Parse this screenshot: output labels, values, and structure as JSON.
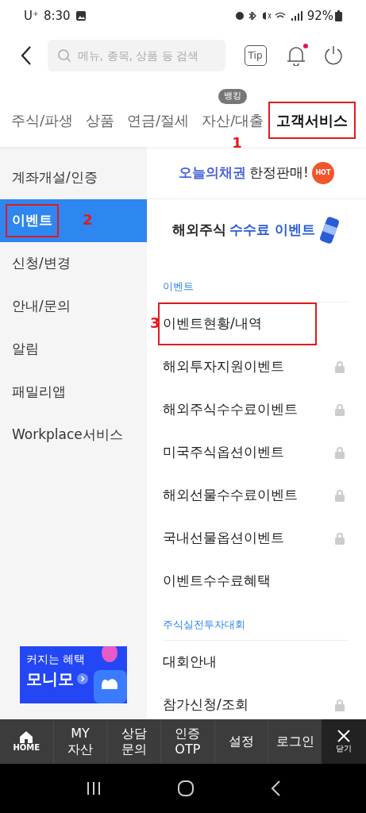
{
  "status_bar": {
    "carrier": "U⁺",
    "time": "8:30",
    "battery": "92%"
  },
  "header": {
    "search": {
      "placeholder": "메뉴, 종목, 상품 등 검색"
    },
    "tip": "Tip",
    "notification_dot": true
  },
  "tabs": [
    {
      "label": "주식/파생",
      "selected": false
    },
    {
      "label": "상품",
      "selected": false
    },
    {
      "label": "연금/절세",
      "selected": false
    },
    {
      "label": "자산/대출",
      "selected": false,
      "badge": "뱅킹"
    },
    {
      "label": "고객서비스",
      "selected": true,
      "callout": "1"
    }
  ],
  "sidebar": {
    "items": [
      {
        "label": "계좌개설/인증",
        "selected": false
      },
      {
        "label": "이벤트",
        "selected": true,
        "callout": "2"
      },
      {
        "label": "신청/변경",
        "selected": false
      },
      {
        "label": "안내/문의",
        "selected": false
      },
      {
        "label": "알림",
        "selected": false
      },
      {
        "label": "패밀리앱",
        "selected": false
      },
      {
        "label": "Workplace서비스",
        "selected": false
      }
    ],
    "promo": {
      "line_1": "커지는 혜택",
      "line_2": "모니모"
    }
  },
  "banners": [
    {
      "kind": "bond",
      "highlight": "오늘의채권",
      "text": "한정판매!",
      "badge": "HOT"
    },
    {
      "kind": "fee",
      "text": "해외주식",
      "highlight": "수수료 이벤트"
    }
  ],
  "sections": [
    {
      "title": "이벤트",
      "items": [
        {
          "label": "이벤트현황/내역",
          "locked": false,
          "callout": "3"
        },
        {
          "label": "해외투자지원이벤트",
          "locked": true
        },
        {
          "label": "해외주식수수료이벤트",
          "locked": true
        },
        {
          "label": "미국주식옵션이벤트",
          "locked": true
        },
        {
          "label": "해외선물수수료이벤트",
          "locked": true
        },
        {
          "label": "국내선물옵션이벤트",
          "locked": true
        },
        {
          "label": "이벤트수수료혜택",
          "locked": false
        }
      ]
    },
    {
      "title": "주식실전투자대회",
      "items": [
        {
          "label": "대회안내",
          "locked": false
        },
        {
          "label": "참가신청/조회",
          "locked": true
        }
      ]
    }
  ],
  "bottom_bar": {
    "items": [
      {
        "kind": "home",
        "label": "HOME"
      },
      {
        "kind": "text",
        "label": "MY\n자산"
      },
      {
        "kind": "text",
        "label": "상담\n문의"
      },
      {
        "kind": "text",
        "label": "인증\nOTP"
      },
      {
        "kind": "text",
        "label": "설정"
      },
      {
        "kind": "text",
        "label": "로그인"
      }
    ],
    "close": "닫기"
  }
}
